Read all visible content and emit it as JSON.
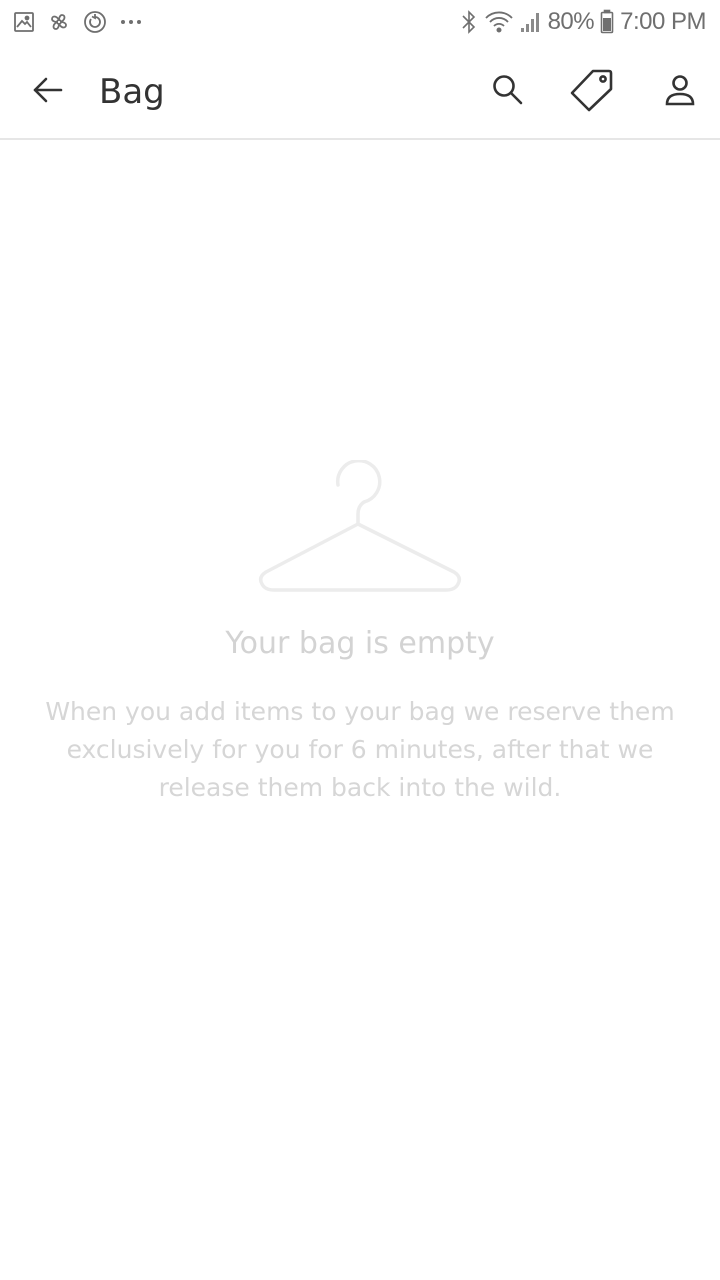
{
  "status_bar": {
    "left_icons": [
      "gallery-icon",
      "pinwheel-icon",
      "sync-icon",
      "more-dots-icon"
    ],
    "battery_percent": "80%",
    "time": "7:00 PM",
    "right_icons": [
      "bluetooth-icon",
      "wifi-icon",
      "signal-icon",
      "battery-icon"
    ]
  },
  "app_bar": {
    "title": "Bag",
    "icons": [
      "back-arrow-icon",
      "search-icon",
      "tag-icon",
      "account-icon"
    ]
  },
  "empty_state": {
    "icon": "hanger-icon",
    "title": "Your bag is empty",
    "message": "When you add items to your bag we reserve them exclusively for you for 6 minutes, after that we release them back into the wild."
  },
  "colors": {
    "background": "#ffffff",
    "title_text": "#333333",
    "icon": "#333333",
    "empty_text": "#d3d3d3",
    "divider": "#e6e6e6"
  }
}
